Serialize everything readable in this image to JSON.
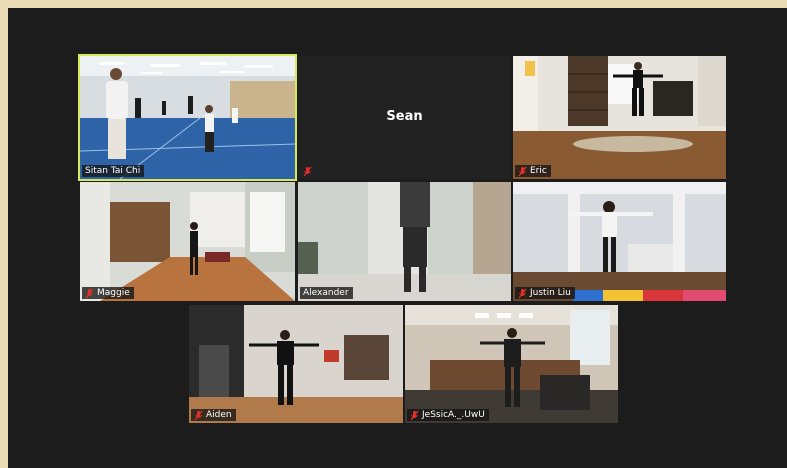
{
  "participants": [
    {
      "name": "Sitan Tai Chi",
      "active": true,
      "muted": false
    },
    {
      "name": "Sean",
      "muted": true,
      "video": false
    },
    {
      "name": "Eric",
      "muted": true
    },
    {
      "name": "Maggie",
      "muted": true
    },
    {
      "name": "Alexander",
      "muted": false
    },
    {
      "name": "Justin Liu",
      "muted": true
    },
    {
      "name": "Aiden",
      "muted": true
    },
    {
      "name": "JeSsicA._.UwU",
      "muted": true
    }
  ],
  "colors": {
    "active_border": "#d7e858",
    "muted_icon": "#e2312b",
    "window_bg": "#1c1c1c",
    "page_bg": "#e9dcb4"
  }
}
